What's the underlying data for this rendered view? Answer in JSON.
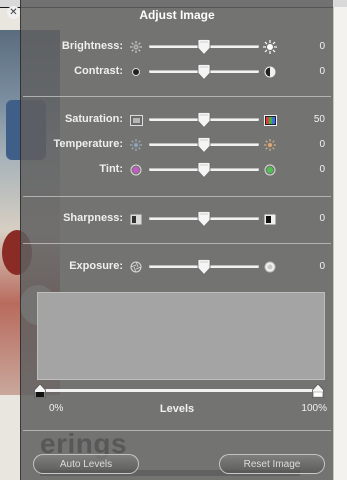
{
  "window": {
    "title": "Adjust Image"
  },
  "adjustments": [
    {
      "label": "Brightness:",
      "value": "0",
      "pos": 0.5,
      "icon_left": "sun-dim-icon",
      "icon_right": "sun-bright-icon"
    },
    {
      "label": "Contrast:",
      "value": "0",
      "pos": 0.5,
      "icon_left": "dot-icon",
      "icon_right": "half-circle-icon"
    },
    {
      "label": "Saturation:",
      "value": "50",
      "pos": 0.5,
      "icon_left": "gray-square-icon",
      "icon_right": "color-square-icon"
    },
    {
      "label": "Temperature:",
      "value": "0",
      "pos": 0.5,
      "icon_left": "cool-sun-icon",
      "icon_right": "warm-sun-icon"
    },
    {
      "label": "Tint:",
      "value": "0",
      "pos": 0.5,
      "icon_left": "magenta-circle-icon",
      "icon_right": "green-circle-icon"
    },
    {
      "label": "Sharpness:",
      "value": "0",
      "pos": 0.5,
      "icon_left": "blur-square-icon",
      "icon_right": "sharp-square-icon"
    },
    {
      "label": "Exposure:",
      "value": "0",
      "pos": 0.5,
      "icon_left": "aperture-icon",
      "icon_right": "bright-circle-icon"
    }
  ],
  "levels": {
    "title": "Levels",
    "min_label": "0%",
    "max_label": "100%",
    "black_point": 0.0,
    "white_point": 1.0
  },
  "buttons": {
    "auto_levels": "Auto Levels",
    "reset_image": "Reset Image"
  },
  "background": {
    "heading_fragment": "erings"
  },
  "colors": {
    "hud_bg": "#5f5f5f",
    "track": "#f2f2f2",
    "histogram": "#a4a4a4"
  }
}
